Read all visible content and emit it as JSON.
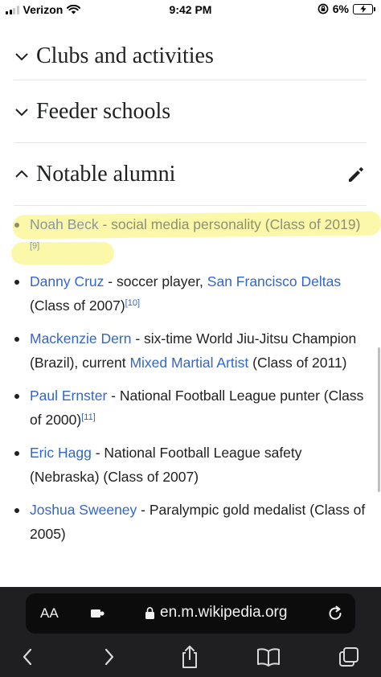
{
  "status_bar": {
    "carrier": "Verizon",
    "time": "9:42 PM",
    "battery_percent": "6%",
    "icons": [
      "signal-icon",
      "wifi-icon",
      "rotation-lock-icon",
      "battery-charging-icon"
    ]
  },
  "sections": {
    "clubs": {
      "title": "Clubs and activities",
      "state": "collapsed"
    },
    "feeder": {
      "title": "Feeder schools",
      "state": "collapsed"
    },
    "alumni": {
      "title": "Notable alumni",
      "state": "expanded"
    }
  },
  "alumni": [
    {
      "name": "Noah Beck",
      "text_before": " - social media personality (Class of 2019)",
      "ref": "[9]",
      "highlighted": true
    },
    {
      "name": "Danny Cruz",
      "text_before": " - soccer player, ",
      "link2": "San Francisco Deltas",
      "text_after": " (Class of 2007)",
      "ref": "[10]"
    },
    {
      "name": "Mackenzie Dern",
      "text_before": " - six-time World Jiu-Jitsu Champion (Brazil), current ",
      "link2": "Mixed Martial Artist",
      "text_after": " (Class of 2011)"
    },
    {
      "name": "Paul Ernster",
      "text_before": " - National Football League punter (Class of 2000)",
      "ref": "[11]"
    },
    {
      "name": "Eric Hagg",
      "text_before": " - National Football League safety (Nebraska) (Class of 2007)"
    },
    {
      "name": "Joshua Sweeney",
      "text_before": " - Paralympic gold medalist (Class of 2005)"
    }
  ],
  "browser": {
    "aa_label": "AA",
    "url": "en.m.wikipedia.org"
  },
  "colors": {
    "link": "#3366cc",
    "highlight": "#f9f78c",
    "chrome_bg": "#1f1f21"
  }
}
